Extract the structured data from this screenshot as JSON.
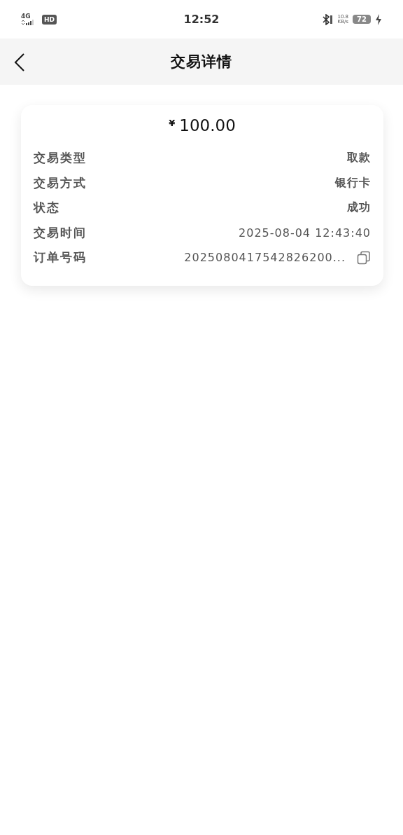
{
  "status_bar": {
    "network": "4G",
    "hd": "HD",
    "time": "12:52",
    "speed_value": "10.8",
    "speed_unit": "KB/s",
    "battery": "72"
  },
  "header": {
    "title": "交易详情"
  },
  "card": {
    "currency": "¥",
    "amount": "100.00",
    "rows": [
      {
        "kind": "text",
        "label": "交易类型",
        "value": "取款"
      },
      {
        "kind": "text",
        "label": "交易方式",
        "value": "银行卡"
      },
      {
        "kind": "text",
        "label": "状态",
        "value": "成功"
      },
      {
        "kind": "text",
        "label": "交易时间",
        "value": "2025-08-04 12:43:40"
      },
      {
        "kind": "copy",
        "label": "订单号码",
        "value": "2025080417542826200..."
      }
    ]
  }
}
